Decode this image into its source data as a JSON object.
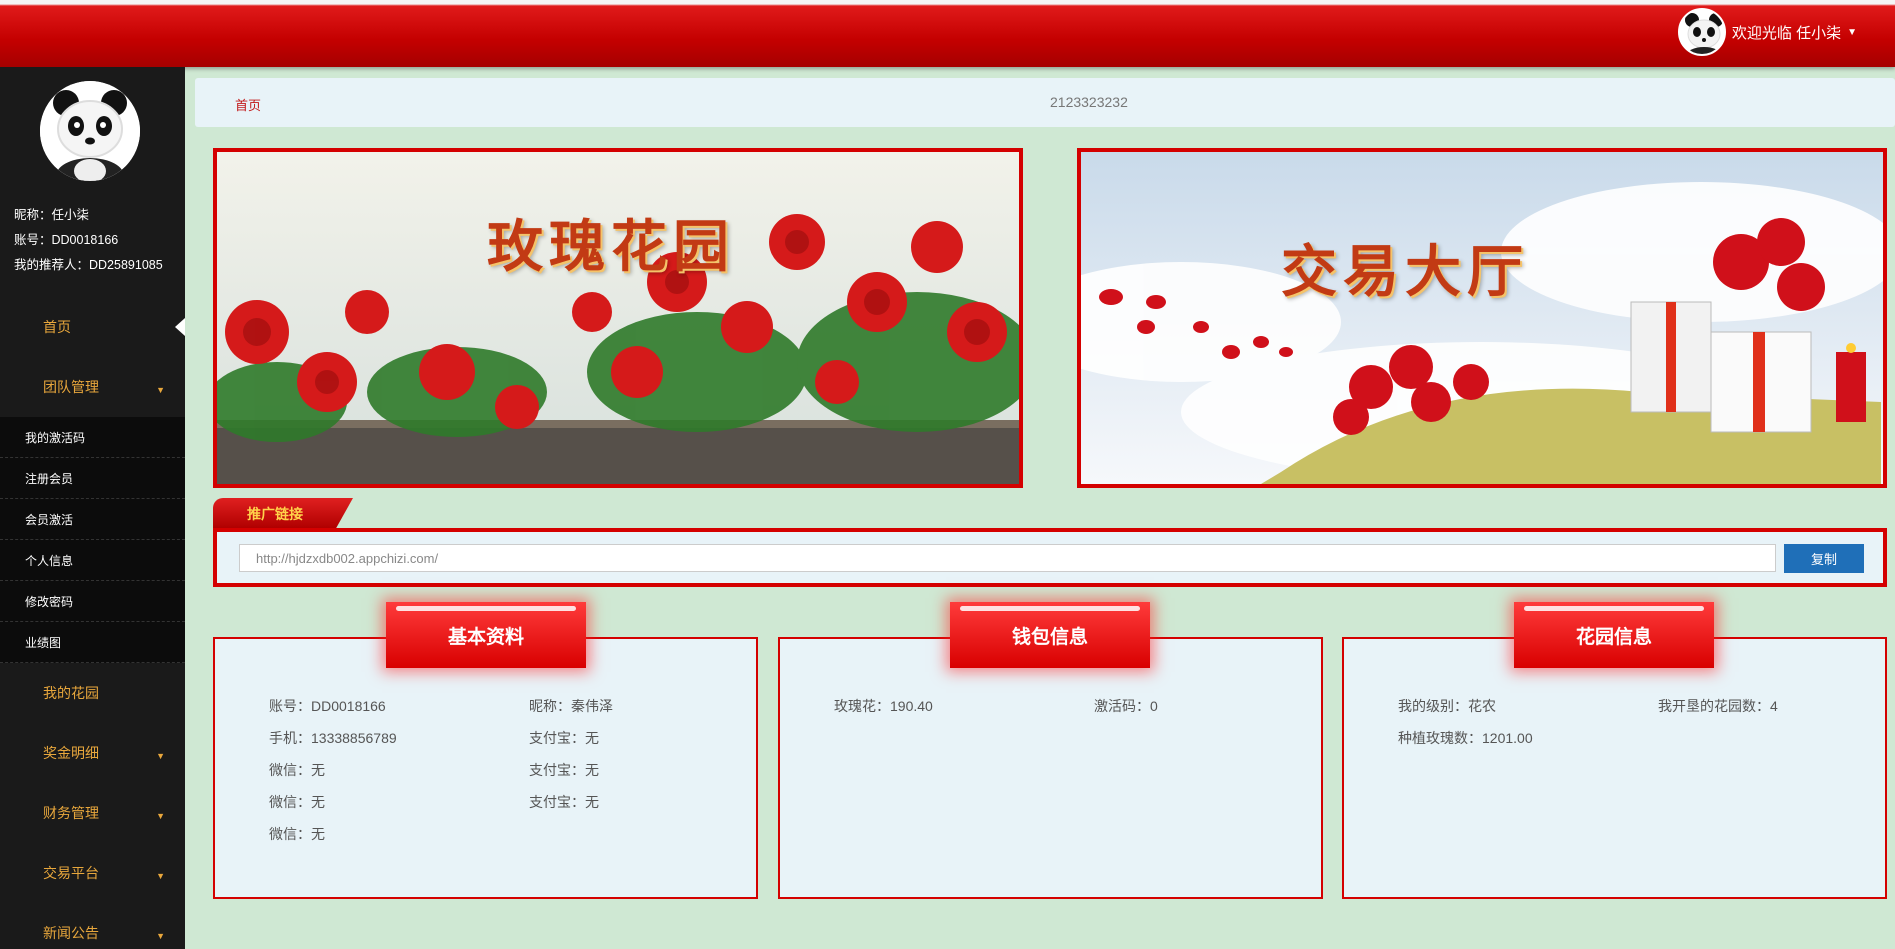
{
  "header": {
    "welcome": "欢迎光临 任小柒"
  },
  "sidebar": {
    "nickname": "昵称：任小柒",
    "account": "账号：DD0018166",
    "referrer": "我的推荐人：DD25891085",
    "nav": {
      "home": "首页",
      "team": "团队管理",
      "team_items": [
        "我的激活码",
        "注册会员",
        "会员激活",
        "个人信息",
        "修改密码",
        "业绩图"
      ],
      "garden": "我的花园",
      "bonus": "奖金明细",
      "finance": "财务管理",
      "trade": "交易平台",
      "news": "新闻公告"
    }
  },
  "breadcrumb": {
    "home": "首页",
    "notice": "2123323232"
  },
  "banners": {
    "rose_garden": "玫瑰花园",
    "trade_hall": "交易大厅"
  },
  "promo": {
    "tab": "推广链接",
    "url": "http://hjdzxdb002.appchizi.com/",
    "copy": "复制"
  },
  "cards": {
    "basic": {
      "title": "基本资料",
      "fields": [
        "账号：DD0018166",
        "昵称：秦伟泽",
        "手机：13338856789",
        "支付宝：无",
        "微信：无",
        "支付宝：无",
        "微信：无",
        "支付宝：无",
        "微信：无"
      ]
    },
    "wallet": {
      "title": "钱包信息",
      "fields": [
        "玫瑰花：190.40",
        "激活码：0"
      ]
    },
    "garden": {
      "title": "花园信息",
      "fields": [
        "我的级别：花农",
        "我开垦的花园数：4",
        "种植玫瑰数：1201.00"
      ]
    }
  }
}
